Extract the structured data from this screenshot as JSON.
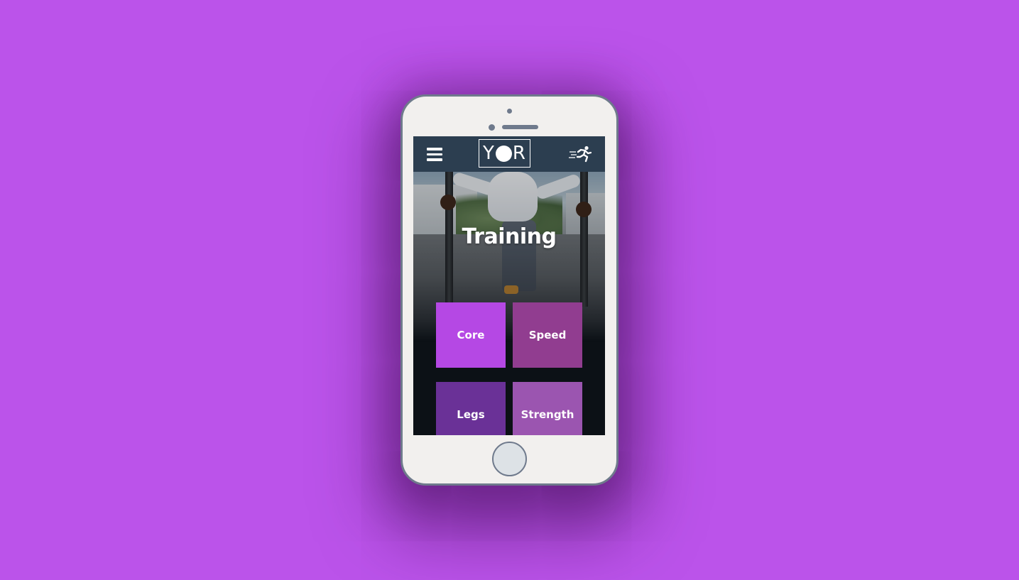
{
  "header": {
    "logo_text_left": "Y",
    "logo_text_right": "R",
    "menu_icon": "hamburger-menu-icon",
    "action_icon": "running-person-icon"
  },
  "hero": {
    "title": "Training"
  },
  "categories": [
    {
      "label": "Core",
      "color": "#b548e4"
    },
    {
      "label": "Speed",
      "color": "#913d90"
    },
    {
      "label": "Legs",
      "color": "#6a3197"
    },
    {
      "label": "Strength",
      "color": "#9b55b0"
    }
  ],
  "colors": {
    "background": "#bb53ea",
    "topbar": "#2c3e50",
    "phone_body": "#f2f0ee",
    "phone_frame": "#6f7a8c"
  }
}
